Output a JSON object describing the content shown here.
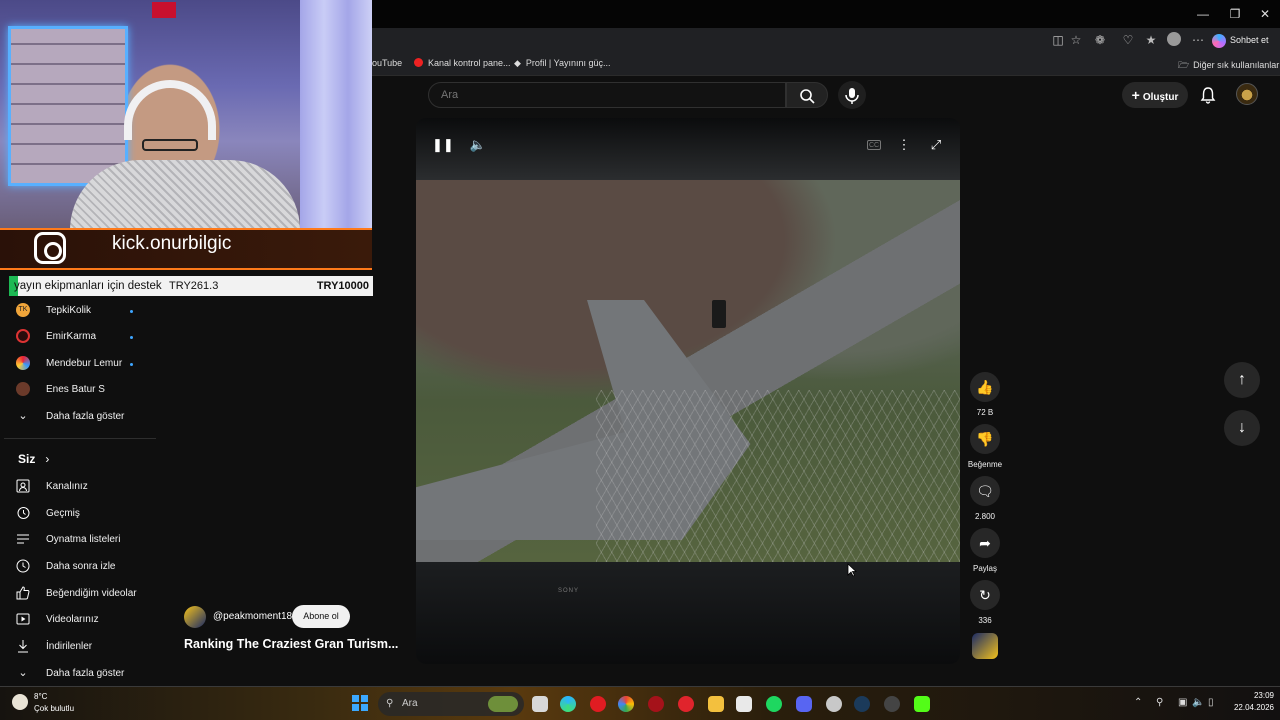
{
  "browser": {
    "chat_label": "Sohbet et",
    "bookmarks": [
      {
        "label": "ouTube"
      },
      {
        "label": "Kanal kontrol pane..."
      },
      {
        "label": "Profil | Yayınını güç..."
      }
    ],
    "other_bookmarks": "Diğer sık kullanılanlar"
  },
  "header": {
    "search_placeholder": "Ara",
    "create_label": "Oluştur"
  },
  "stream_overlay": {
    "instagram_handle": "kick.onurbilgic",
    "donation_text": "yayın ekipmanları için destek",
    "donation_current": "TRY261.3",
    "donation_goal": "TRY10000",
    "donation_progress": 0.026
  },
  "sidebar": {
    "subscriptions": [
      {
        "name": "TepkiKolik",
        "live": true
      },
      {
        "name": "EmirKarma",
        "live": true
      },
      {
        "name": "Mendebur Lemur",
        "live": true
      },
      {
        "name": "Enes Batur S",
        "live": false
      }
    ],
    "show_more": "Daha fazla göster",
    "you_section": "Siz",
    "you_items": [
      {
        "label": "Kanalınız",
        "icon": "channel-icon"
      },
      {
        "label": "Geçmiş",
        "icon": "history-icon"
      },
      {
        "label": "Oynatma listeleri",
        "icon": "playlists-icon"
      },
      {
        "label": "Daha sonra izle",
        "icon": "watch-later-icon"
      },
      {
        "label": "Beğendiğim videolar",
        "icon": "liked-icon"
      },
      {
        "label": "Videolarınız",
        "icon": "your-videos-icon"
      },
      {
        "label": "İndirilenler",
        "icon": "downloads-icon"
      }
    ],
    "show_more_2": "Daha fazla göster"
  },
  "short": {
    "channel_handle": "@peakmoment18",
    "subscribe_label": "Abone ol",
    "title": "Ranking The Craziest Gran Turism...",
    "likes": "72 B",
    "dislike_label": "Beğenme",
    "comments": "2.800",
    "share_label": "Paylaş",
    "remix_count": "336",
    "video_bottom_text": "SONY"
  },
  "taskbar": {
    "weather_temp": "8°C",
    "weather_desc": "Çok bulutlu",
    "search_placeholder": "Ara",
    "time": "23:09",
    "date": "22.04.2026"
  },
  "colors": {
    "accent_orange": "#ff7a1a",
    "live_dot": "#3ea6ff",
    "progress_green": "#1db954"
  }
}
